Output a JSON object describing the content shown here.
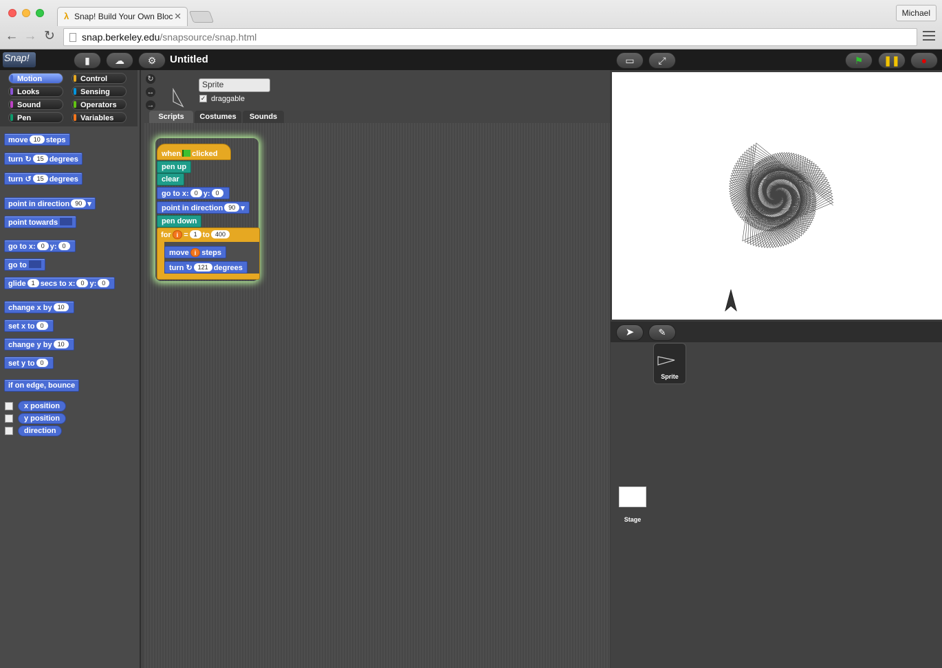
{
  "browser": {
    "tab_title": "Snap! Build Your Own Bloc",
    "user_name": "Michael",
    "url_host": "snap.berkeley.edu",
    "url_path": "/snapsource/snap.html"
  },
  "toolbar": {
    "logo": "Snap!",
    "project_title": "Untitled"
  },
  "categories": [
    "Motion",
    "Looks",
    "Sound",
    "Pen",
    "Control",
    "Sensing",
    "Operators",
    "Variables"
  ],
  "category_colors": [
    "#4a6cd4",
    "#8a55d7",
    "#bb42c3",
    "#0e9a6c",
    "#e6a822",
    "#0494dc",
    "#62c213",
    "#f3761d"
  ],
  "palette": {
    "move": {
      "a": "move",
      "v": "10",
      "b": "steps"
    },
    "turn_cw": {
      "a": "turn",
      "v": "15",
      "b": "degrees"
    },
    "turn_ccw": {
      "a": "turn",
      "v": "15",
      "b": "degrees"
    },
    "point_dir": {
      "a": "point in direction",
      "v": "90"
    },
    "point_towards": {
      "a": "point towards"
    },
    "goto_xy": {
      "a": "go to x:",
      "x": "0",
      "b": "y:",
      "y": "0"
    },
    "goto": {
      "a": "go to"
    },
    "glide": {
      "a": "glide",
      "s": "1",
      "b": "secs to x:",
      "x": "0",
      "c": "y:",
      "y": "0"
    },
    "change_x": {
      "a": "change x by",
      "v": "10"
    },
    "set_x": {
      "a": "set x to",
      "v": "0"
    },
    "change_y": {
      "a": "change y by",
      "v": "10"
    },
    "set_y": {
      "a": "set y to",
      "v": "0"
    },
    "bounce": {
      "a": "if on edge, bounce"
    },
    "xpos": "x position",
    "ypos": "y position",
    "direction": "direction"
  },
  "sprite": {
    "name": "Sprite",
    "draggable_label": "draggable",
    "draggable_checked": "✓"
  },
  "editor_tabs": [
    "Scripts",
    "Costumes",
    "Sounds"
  ],
  "script": {
    "when": "when",
    "clicked": "clicked",
    "pen_up": "pen up",
    "clear": "clear",
    "goto": {
      "a": "go to x:",
      "x": "0",
      "b": "y:",
      "y": "0"
    },
    "point": {
      "a": "point in direction",
      "v": "90"
    },
    "pen_down": "pen down",
    "for": {
      "a": "for",
      "var": "i",
      "eq": "=",
      "from": "1",
      "to_label": "to",
      "to": "400"
    },
    "move": {
      "a": "move",
      "var": "i",
      "b": "steps"
    },
    "turn": {
      "a": "turn",
      "v": "121",
      "b": "degrees"
    }
  },
  "corral": {
    "sprite_label": "Sprite",
    "stage_label": "Stage"
  }
}
